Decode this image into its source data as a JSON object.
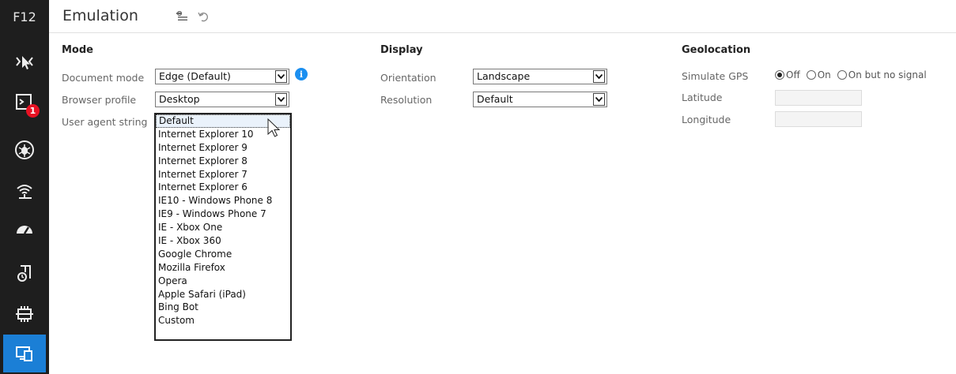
{
  "sidebar": {
    "f12_label": "F12",
    "tools": [
      {
        "icon": "dom-explorer-icon"
      },
      {
        "icon": "console-icon",
        "badge": "1"
      },
      {
        "icon": "debugger-icon"
      },
      {
        "icon": "network-icon"
      },
      {
        "icon": "performance-icon"
      },
      {
        "icon": "memory-icon"
      },
      {
        "icon": "ui-responsiveness-icon"
      },
      {
        "icon": "emulation-icon",
        "active": true
      }
    ]
  },
  "header": {
    "title": "Emulation",
    "reset_icon": "settings-reset-icon",
    "undo_icon": "undo-icon"
  },
  "mode": {
    "section_title": "Mode",
    "document_mode_label": "Document mode",
    "document_mode_value": "Edge (Default)",
    "browser_profile_label": "Browser profile",
    "browser_profile_value": "Desktop",
    "user_agent_label": "User agent string",
    "user_agent_options": [
      "Default",
      "Internet Explorer 10",
      "Internet Explorer 9",
      "Internet Explorer 8",
      "Internet Explorer 7",
      "Internet Explorer 6",
      "IE10 - Windows Phone 8",
      "IE9 - Windows Phone 7",
      "IE - Xbox One",
      "IE - Xbox 360",
      "Google Chrome",
      "Mozilla Firefox",
      "Opera",
      "Apple Safari (iPad)",
      "Bing Bot",
      "Custom"
    ],
    "user_agent_selected": "Default",
    "info_glyph": "i"
  },
  "display": {
    "section_title": "Display",
    "orientation_label": "Orientation",
    "orientation_value": "Landscape",
    "resolution_label": "Resolution",
    "resolution_value": "Default"
  },
  "geolocation": {
    "section_title": "Geolocation",
    "simulate_gps_label": "Simulate GPS",
    "gps_options": [
      "Off",
      "On",
      "On but no signal"
    ],
    "gps_selected": "Off",
    "latitude_label": "Latitude",
    "latitude_value": "",
    "longitude_label": "Longitude",
    "longitude_value": ""
  },
  "colors": {
    "sidebar_bg": "#1e1e1e",
    "accent": "#1b7fd6",
    "badge": "#e81123"
  }
}
